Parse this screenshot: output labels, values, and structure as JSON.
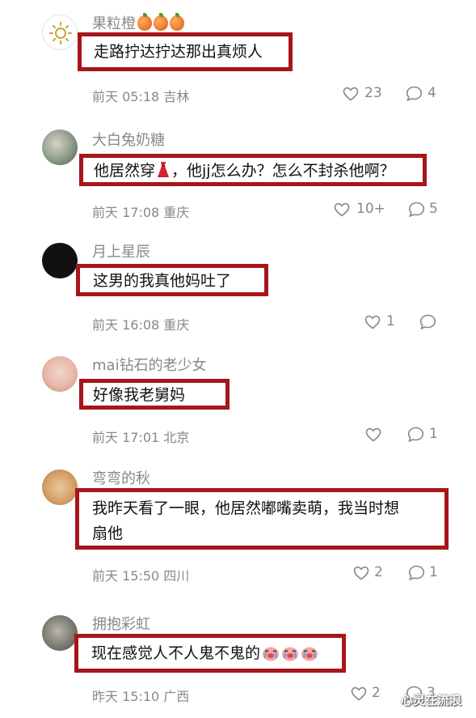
{
  "comments": [
    {
      "user": "果粒橙",
      "content": "走路拧达拧达那出真烦人",
      "time": "前天 05:18",
      "location": "吉林",
      "likes": "23",
      "replies": "4"
    },
    {
      "user": "大白兔奶糖",
      "content_a": "他居然穿",
      "content_b": "，他jj怎么办？怎么不封杀他啊？",
      "time": "前天 17:08",
      "location": "重庆",
      "likes": "10+",
      "replies": "5"
    },
    {
      "user": "月上星辰",
      "content": "这男的我真他妈吐了",
      "time": "前天 16:08",
      "location": "重庆",
      "likes": "1",
      "replies": ""
    },
    {
      "user": "mai钻石的老少女",
      "content": "好像我老舅妈",
      "time": "前天 17:01",
      "location": "北京",
      "likes": "",
      "replies": "1"
    },
    {
      "user": "弯弯的秋",
      "content_line1": "我昨天看了一眼，他居然嘟嘴卖萌，我当时想",
      "content_line2": "扇他",
      "time": "前天 15:50",
      "location": "四川",
      "likes": "2",
      "replies": "1"
    },
    {
      "user": "拥抱彩虹",
      "content": "现在感觉人不人鬼不鬼的",
      "time": "昨天 15:10",
      "location": "广西",
      "likes": "2",
      "replies": "3"
    }
  ],
  "icons": {
    "like": "heart-outline-icon",
    "reply": "speech-bubble-icon"
  },
  "colors": {
    "highlight_border": "#a6161a",
    "meta_text": "#888888"
  },
  "watermark": "心灵在流浪"
}
